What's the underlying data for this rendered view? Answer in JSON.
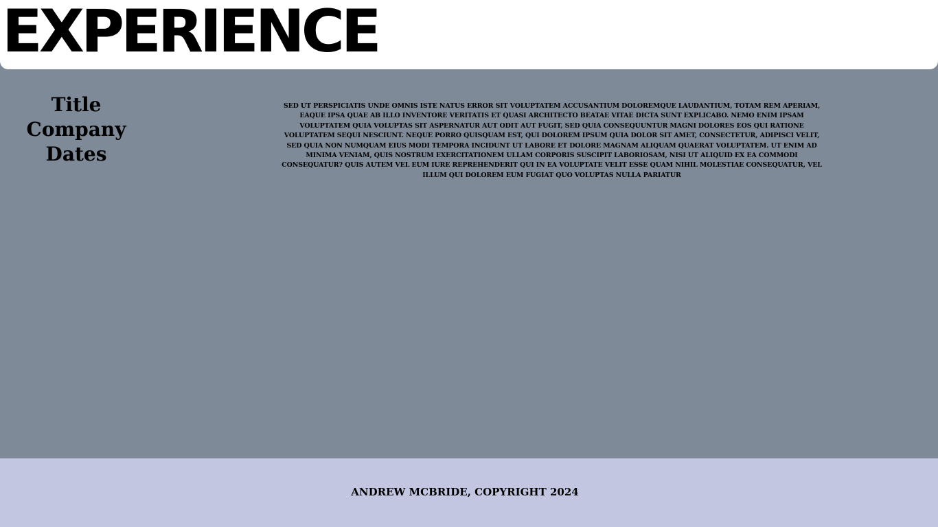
{
  "header": {
    "title": "EXPERIENCE"
  },
  "experience": {
    "title": "Title",
    "company": "Company",
    "dates": "Dates",
    "description": "SED UT PERSPICIATIS UNDE OMNIS ISTE NATUS ERROR SIT VOLUPTATEM ACCUSANTIUM DOLOREMQUE LAUDANTIUM, TOTAM REM APERIAM, EAQUE IPSA QUAE AB ILLO INVENTORE VERITATIS ET QUASI ARCHITECTO BEATAE VITAE DICTA SUNT EXPLICABO. NEMO ENIM IPSAM VOLUPTATEM QUIA VOLUPTAS SIT ASPERNATUR AUT ODIT AUT FUGIT, SED QUIA CONSEQUUNTUR MAGNI DOLORES EOS QUI RATIONE VOLUPTATEM SEQUI NESCIUNT. NEQUE PORRO QUISQUAM EST, QUI DOLOREM IPSUM QUIA DOLOR SIT AMET, CONSECTETUR, ADIPISCI VELIT, SED QUIA NON NUMQUAM EIUS MODI TEMPORA INCIDUNT UT LABORE ET DOLORE MAGNAM ALIQUAM QUAERAT VOLUPTATEM. UT ENIM AD MINIMA VENIAM, QUIS NOSTRUM EXERCITATIONEM ULLAM CORPORIS SUSCIPIT LABORIOSAM, NISI UT ALIQUID EX EA COMMODI CONSEQUATUR? QUIS AUTEM VEL EUM IURE REPREHENDERIT QUI IN EA VOLUPTATE VELIT ESSE QUAM NIHIL MOLESTIAE CONSEQUATUR, VEL ILLUM QUI DOLOREM EUM FUGIAT QUO VOLUPTAS NULLA PARIATUR"
  },
  "footer": {
    "copyright": "ANDREW MCBRIDE, COPYRIGHT 2024"
  },
  "colors": {
    "header_background": "#ffffff",
    "main_background": "#7e8a97",
    "footer_background": "#c2c6e0",
    "text": "#000000"
  }
}
